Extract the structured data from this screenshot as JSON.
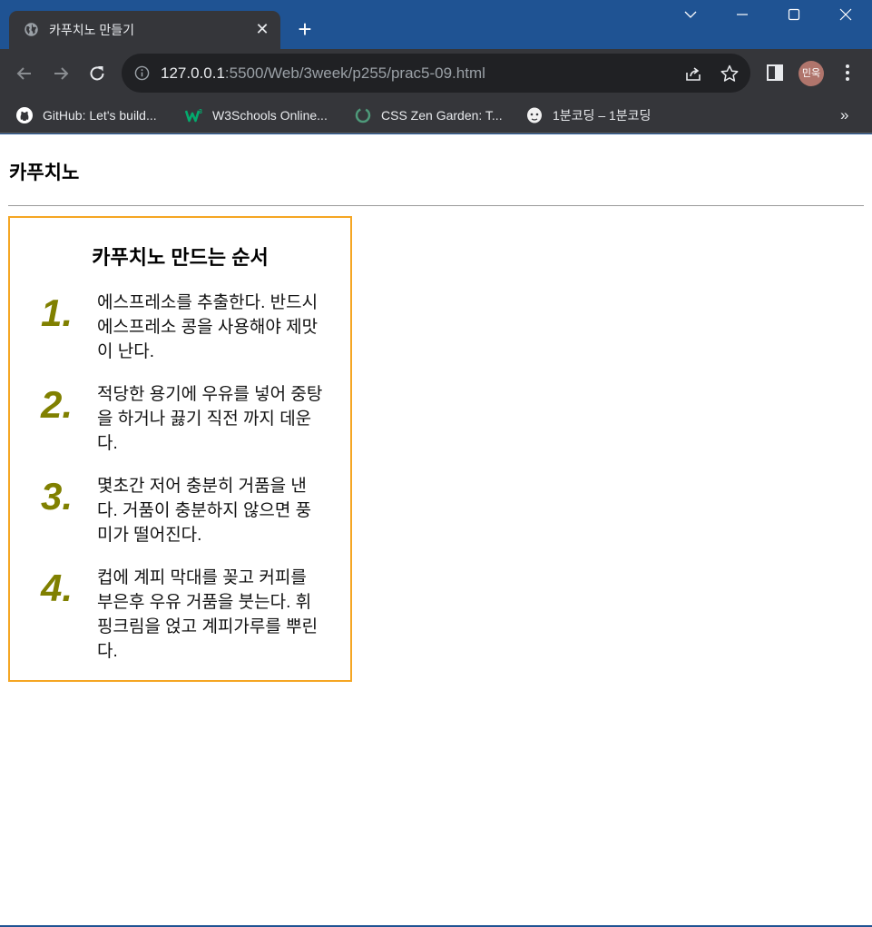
{
  "browser": {
    "tab_title": "카푸치노 만들기",
    "tab_close": "✕",
    "new_tab": "+",
    "url_host": "127.0.0.1",
    "url_rest": ":5500/Web/3week/p255/prac5-09.html",
    "profile_initials": "민욱",
    "bookmarks": [
      {
        "label": "GitHub: Let's build...",
        "icon": "github-icon"
      },
      {
        "label": "W3Schools Online...",
        "icon": "w3schools-icon"
      },
      {
        "label": "CSS Zen Garden: T...",
        "icon": "zen-garden-icon"
      },
      {
        "label": "1분코딩 – 1분코딩",
        "icon": "1bun-coding-icon"
      }
    ],
    "bookmarks_more": "»",
    "colors": {
      "frame": "#1f5393",
      "toolbar": "#35363a",
      "omnibox": "#202124"
    }
  },
  "page": {
    "heading": "카푸치노",
    "recipe": {
      "title": "카푸치노 만드는 순서",
      "steps": [
        {
          "number": "1.",
          "text": "에스프레소를 추출한다. 반드시 에스프레소 콩을 사용해야 제맛이 난다."
        },
        {
          "number": "2.",
          "text": "적당한 용기에 우유를 넣어 중탕을 하거나 끓기 직전 까지 데운다."
        },
        {
          "number": "3.",
          "text": "몇초간 저어 충분히 거품을 낸다. 거품이 충분하지 않으면 풍미가 떨어진다."
        },
        {
          "number": "4.",
          "text": "컵에 계피 막대를 꽂고 커피를 부은후 우유 거품을 붓는다. 휘핑크림을 얹고 계피가루를 뿌린다."
        }
      ]
    },
    "colors": {
      "box_border": "#f5a623",
      "step_number": "#808000"
    }
  }
}
